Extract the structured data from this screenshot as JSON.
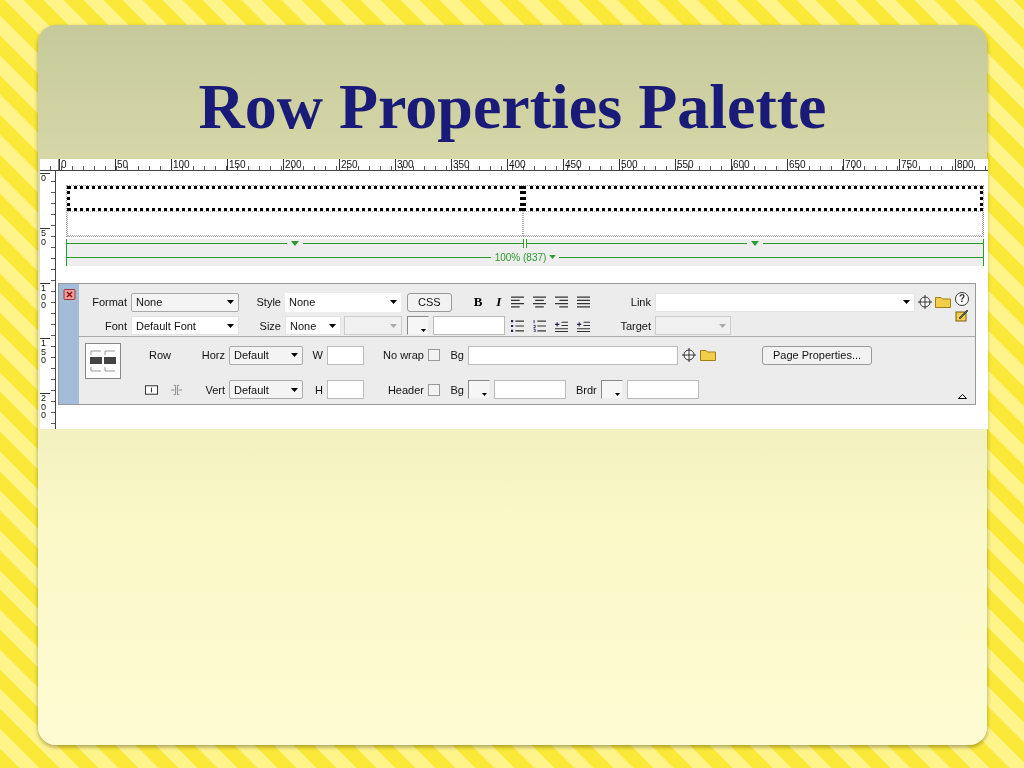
{
  "slide": {
    "title": "Row Properties Palette"
  },
  "ruler_top": {
    "labels": [
      "0",
      "50",
      "100",
      "150",
      "200",
      "250",
      "300",
      "350",
      "400",
      "450",
      "500",
      "550",
      "600",
      "650",
      "700",
      "750",
      "800"
    ]
  },
  "ruler_left": {
    "labels": [
      "0",
      "50",
      "100",
      "150",
      "200"
    ]
  },
  "table": {
    "rows": [
      {
        "selected": true
      },
      {
        "selected": false
      }
    ],
    "width_label": "100% (837)"
  },
  "properties": {
    "format": {
      "label": "Format",
      "value": "None"
    },
    "style": {
      "label": "Style",
      "value": "None"
    },
    "css_button": "CSS",
    "bold_button": "B",
    "italic_button": "I",
    "link": {
      "label": "Link"
    },
    "font": {
      "label": "Font",
      "value": "Default Font"
    },
    "size": {
      "label": "Size",
      "value": "None"
    },
    "size_unit": {
      "disabled": true
    },
    "target": {
      "label": "Target",
      "disabled": true
    },
    "row_label": "Row",
    "horz": {
      "label": "Horz",
      "value": "Default"
    },
    "vert": {
      "label": "Vert",
      "value": "Default"
    },
    "width": {
      "label": "W"
    },
    "height": {
      "label": "H"
    },
    "no_wrap": {
      "label": "No wrap",
      "checked": false
    },
    "header": {
      "label": "Header",
      "checked": false
    },
    "background_image": {
      "label": "Bg"
    },
    "background_color": {
      "label": "Bg"
    },
    "border_color": {
      "label": "Brdr"
    },
    "page_properties_button": "Page Properties...",
    "help_button": "?"
  }
}
